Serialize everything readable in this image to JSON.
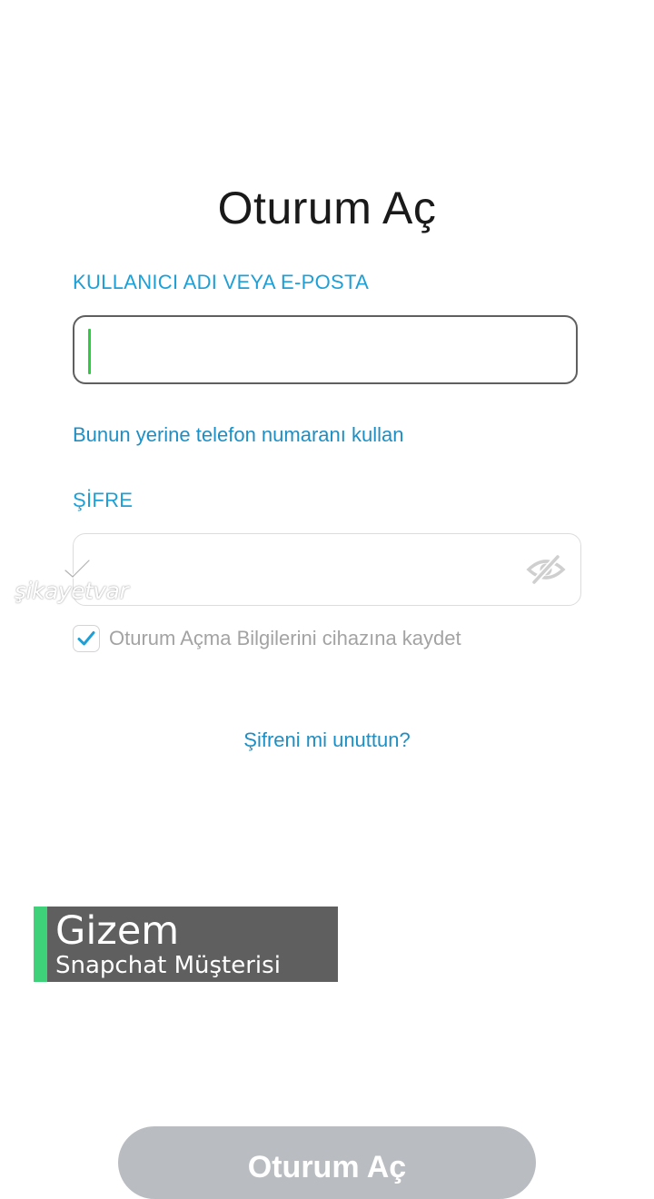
{
  "header": {
    "title": "Oturum Aç"
  },
  "username": {
    "label": "KULLANICI ADI VEYA E-POSTA",
    "value": "",
    "placeholder": ""
  },
  "phone_link": "Bunun yerine telefon numaranı kullan",
  "password": {
    "label": "ŞİFRE",
    "value": "",
    "toggle_icon": "eye-slash-icon"
  },
  "save_login": {
    "label": "Oturum Açma Bilgilerini cihazına kaydet",
    "checked": true
  },
  "forgot_link": "Şifreni mi unuttun?",
  "watermark": {
    "text": "şikayetvar"
  },
  "caption": {
    "name": "Gizem",
    "role": "Snapchat Müşterisi"
  },
  "login_button": {
    "label": "Oturum Aç"
  },
  "colors": {
    "accent": "#1ea0d6",
    "cursor": "#2ecc40",
    "badge_accent": "#3fd17a",
    "button_disabled": "#b9bcc0"
  }
}
